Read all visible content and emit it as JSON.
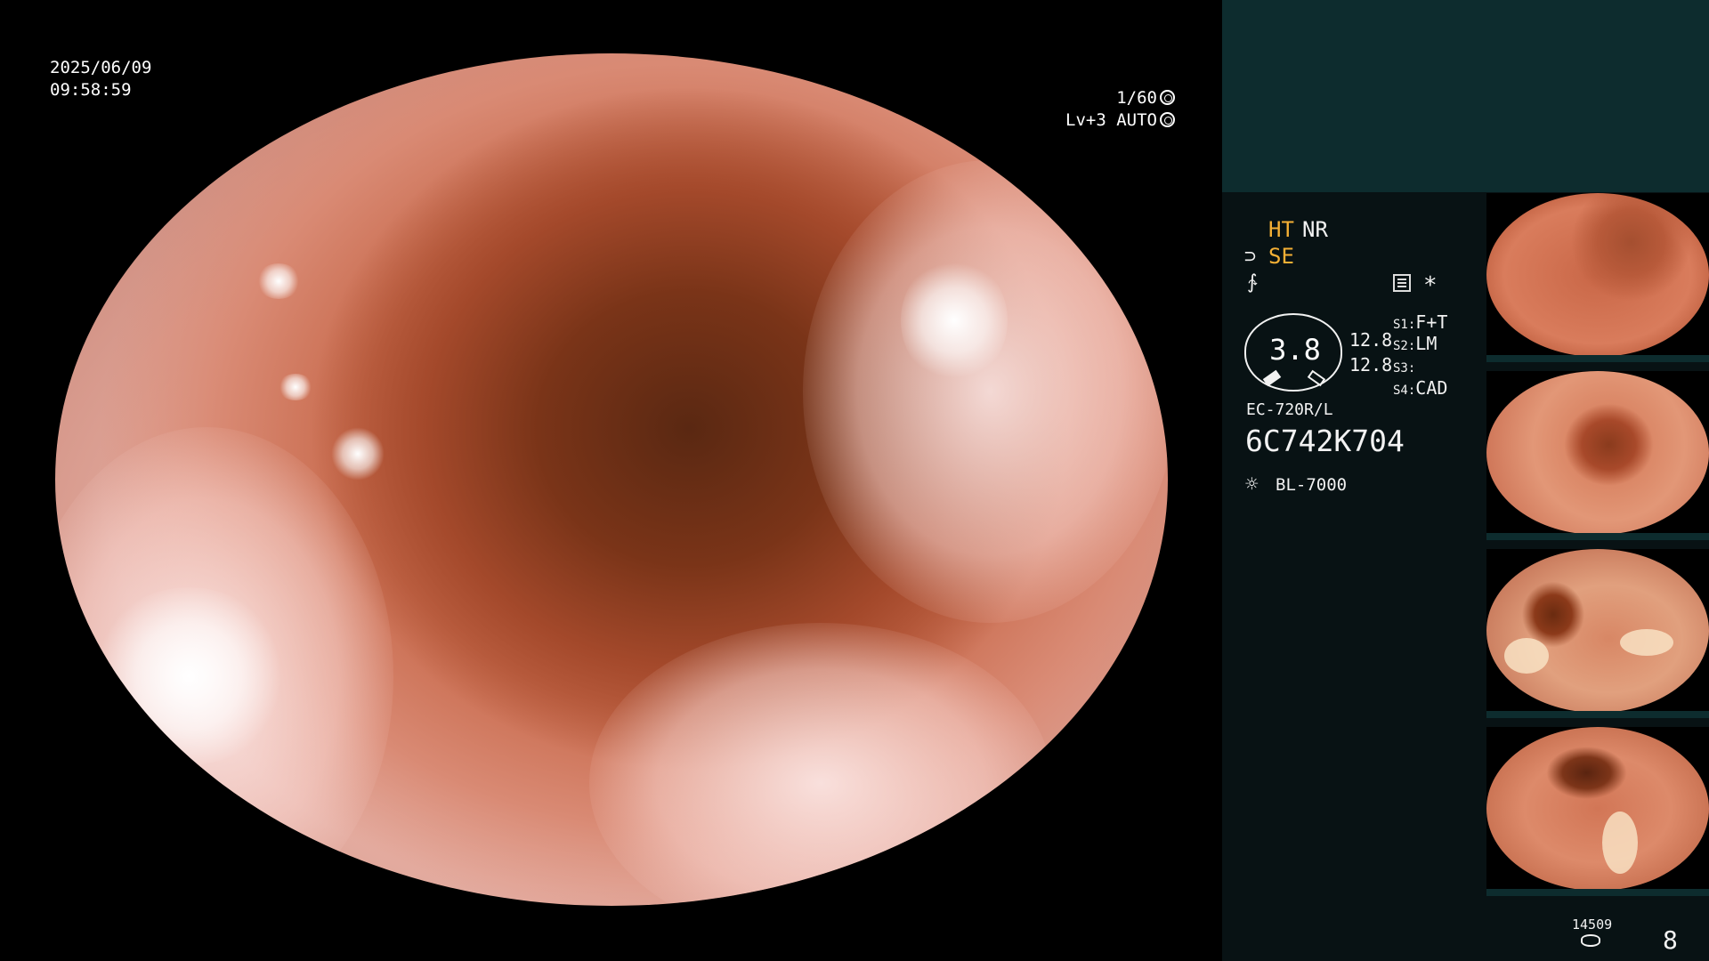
{
  "overlay": {
    "date": "2025/06/09",
    "time": "09:58:59",
    "shutter": "1/60",
    "level": "Lv+3",
    "iris_mode": "AUTO"
  },
  "panel": {
    "ht": "HT",
    "nr": "NR",
    "se": "SE",
    "meter_value": "3.8",
    "values": [
      "12.8",
      "12.8"
    ],
    "switches": [
      {
        "label": "S1:",
        "value": "F+T"
      },
      {
        "label": "S2:",
        "value": "LM"
      },
      {
        "label": "S3:",
        "value": ""
      },
      {
        "label": "S4:",
        "value": "CAD"
      }
    ],
    "scope_model": "EC-720R/L",
    "scope_serial": "6C742K704",
    "light_source": "BL-7000",
    "asterisk": "*"
  },
  "counters": {
    "remaining": "14509",
    "captured": "8"
  },
  "icons": {
    "shutter": "shutter-icon",
    "iris": "iris-icon",
    "structure": "structure-enhance-icon",
    "color": "color-mode-icon",
    "menu": "menu-icon",
    "light": "light-source-icon",
    "storage": "storage-icon"
  },
  "colors": {
    "accent": "#f5b035",
    "panel_bg": "#081214",
    "panel_top": "#0d2c2e"
  }
}
